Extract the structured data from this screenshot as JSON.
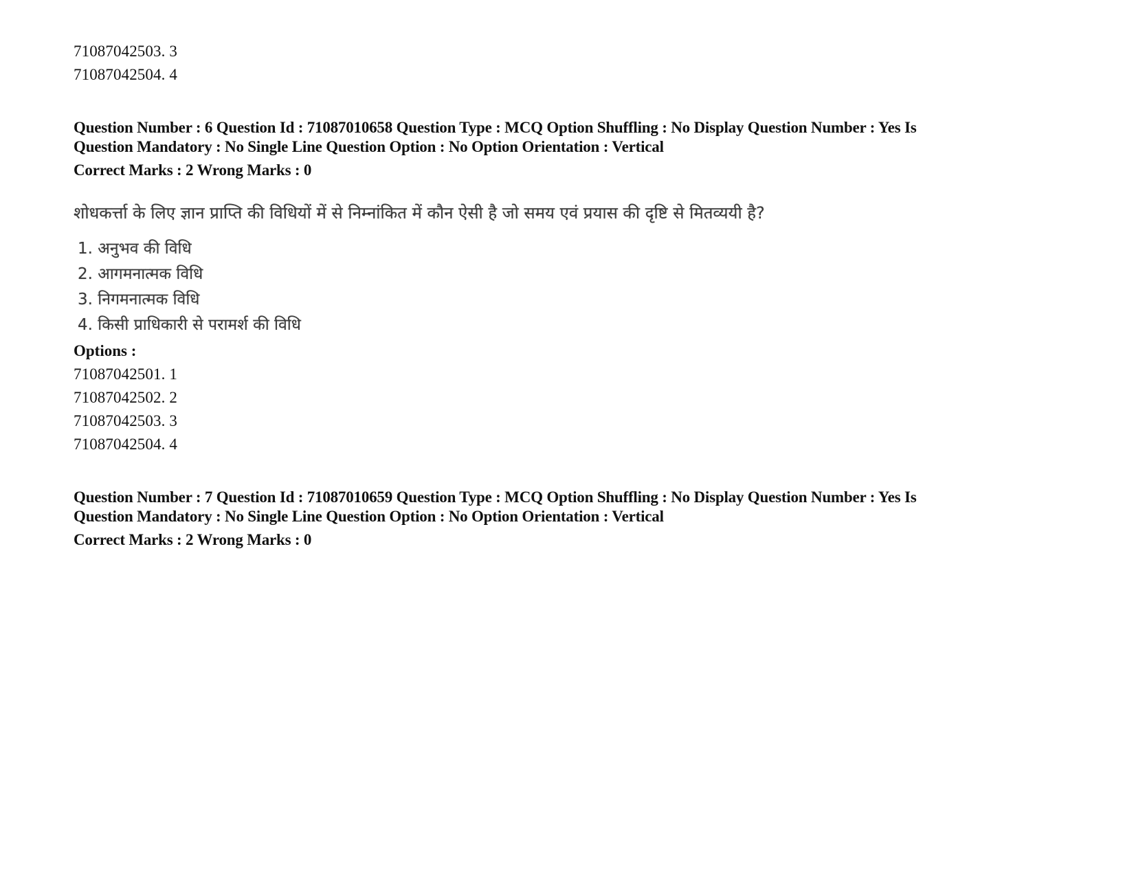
{
  "prev_options": [
    {
      "id": "71087042503",
      "value": "3"
    },
    {
      "id": "71087042504",
      "value": "4"
    }
  ],
  "questions": [
    {
      "meta_line1": "Question Number : 6 Question Id : 71087010658 Question Type : MCQ Option Shuffling : No Display Question Number : Yes Is",
      "meta_line2": "Question Mandatory : No Single Line Question Option : No Option Orientation : Vertical",
      "marks": "Correct Marks : 2 Wrong Marks : 0",
      "question_text": "शोधकर्त्ता के लिए ज्ञान प्राप्ति की विधियों में से निम्नांकित में कौन ऐसी है जो समय एवं प्रयास की दृष्टि से मितव्ययी है?",
      "choices": [
        "1. अनुभव की विधि",
        "2. आगमनात्मक विधि",
        "3. निगमनात्मक विधि",
        "4. किसी प्राधिकारी से परामर्श की विधि"
      ],
      "options_label": "Options :",
      "options": [
        {
          "id": "71087042501",
          "value": "1"
        },
        {
          "id": "71087042502",
          "value": "2"
        },
        {
          "id": "71087042503",
          "value": "3"
        },
        {
          "id": "71087042504",
          "value": "4"
        }
      ]
    },
    {
      "meta_line1": "Question Number : 7 Question Id : 71087010659 Question Type : MCQ Option Shuffling : No Display Question Number : Yes Is",
      "meta_line2": "Question Mandatory : No Single Line Question Option : No Option Orientation : Vertical",
      "marks": "Correct Marks : 2 Wrong Marks : 0"
    }
  ]
}
